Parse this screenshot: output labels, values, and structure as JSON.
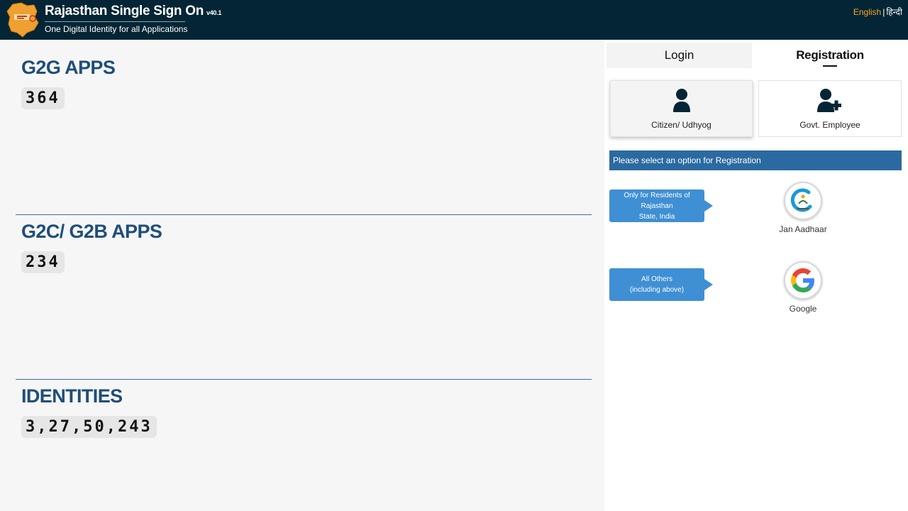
{
  "header": {
    "title": "Rajasthan Single Sign On",
    "version": "v40.1",
    "subtitle": "One Digital Identity for all Applications",
    "lang_english": "English",
    "lang_separator": "|",
    "lang_hindi": "हिन्दी"
  },
  "stats": [
    {
      "title": "G2G APPS",
      "count": "364"
    },
    {
      "title": "G2C/ G2B APPS",
      "count": "234"
    },
    {
      "title": "IDENTITIES",
      "count": "3,27,50,243"
    }
  ],
  "tabs": {
    "login": "Login",
    "registration": "Registration",
    "active": "Registration"
  },
  "cards": {
    "citizen": "Citizen/ Udhyog",
    "govt": "Govt. Employee"
  },
  "notice": "Please select an option for Registration",
  "callouts": {
    "residents_line1": "Only for Residents of Rajasthan",
    "residents_line2": "State, India",
    "others_line1": "All Others",
    "others_line2": "(including above)"
  },
  "providers": {
    "jan_aadhaar": "Jan Aadhaar",
    "google": "Google"
  },
  "colors": {
    "topbar": "#032535",
    "heading": "#1f4e79",
    "notice_bg": "#2b6aa1",
    "callout_bg": "#3f8fd4",
    "lang_active": "#f5a623"
  }
}
